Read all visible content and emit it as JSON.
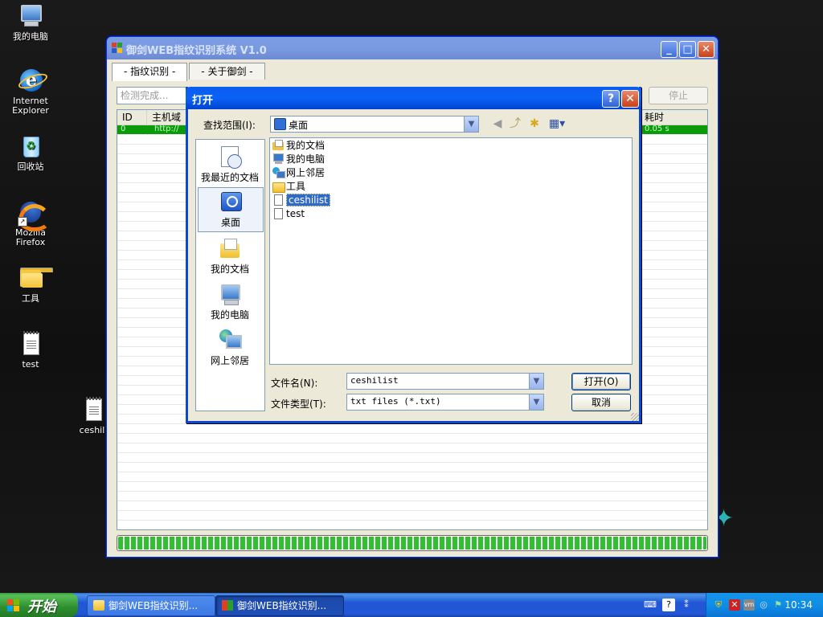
{
  "desktop": {
    "icons": [
      {
        "label": "我的电脑",
        "icon": "my-computer-icon"
      },
      {
        "label": "Internet\nExplorer",
        "label1": "Internet",
        "label2": "Explorer",
        "icon": "internet-explorer-icon"
      },
      {
        "label": "回收站",
        "icon": "recycle-bin-icon"
      },
      {
        "label1": "Mozilla",
        "label2": "Firefox",
        "icon": "firefox-icon"
      },
      {
        "label": "工具",
        "icon": "folder-icon"
      },
      {
        "label": "test",
        "icon": "notepad-file-icon"
      },
      {
        "label": "ceshili",
        "icon": "notepad-file-icon"
      }
    ]
  },
  "app": {
    "title": "御剑WEB指纹识别系统 V1.0",
    "tabs": [
      {
        "label": "- 指纹识别 -"
      },
      {
        "label": "- 关于御剑 -"
      }
    ],
    "status_field": "检测完成...",
    "stop_button": "停止",
    "grid": {
      "columns": [
        "ID",
        "主机域",
        "耗时"
      ],
      "rows": [
        {
          "id": "0",
          "host": "http://",
          "time": "0.05 s"
        }
      ]
    }
  },
  "dialog": {
    "title": "打开",
    "look_in_label": "查找范围(I):",
    "look_in_value": "桌面",
    "places": [
      {
        "label": "我最近的文档",
        "icon": "recent-documents-icon"
      },
      {
        "label": "桌面",
        "icon": "desktop-icon"
      },
      {
        "label": "我的文档",
        "icon": "my-documents-icon"
      },
      {
        "label": "我的电脑",
        "icon": "my-computer-icon"
      },
      {
        "label": "网上邻居",
        "icon": "network-places-icon"
      }
    ],
    "files": [
      {
        "name": "我的文档",
        "icon": "my-documents-icon"
      },
      {
        "name": "我的电脑",
        "icon": "my-computer-icon"
      },
      {
        "name": "网上邻居",
        "icon": "network-places-icon"
      },
      {
        "name": "工具",
        "icon": "folder-icon"
      },
      {
        "name": "ceshilist",
        "icon": "text-file-icon",
        "selected": true
      },
      {
        "name": "test",
        "icon": "text-file-icon"
      }
    ],
    "file_name_label": "文件名(N):",
    "file_name_value": "ceshilist",
    "file_type_label": "文件类型(T):",
    "file_type_value": "txt files (*.txt)",
    "open_button": "打开(O)",
    "cancel_button": "取消"
  },
  "taskbar": {
    "start_label": "开始",
    "tasks": [
      {
        "label": "御剑WEB指纹识别..."
      },
      {
        "label": "御剑WEB指纹识别..."
      }
    ],
    "clock": "10:34"
  }
}
